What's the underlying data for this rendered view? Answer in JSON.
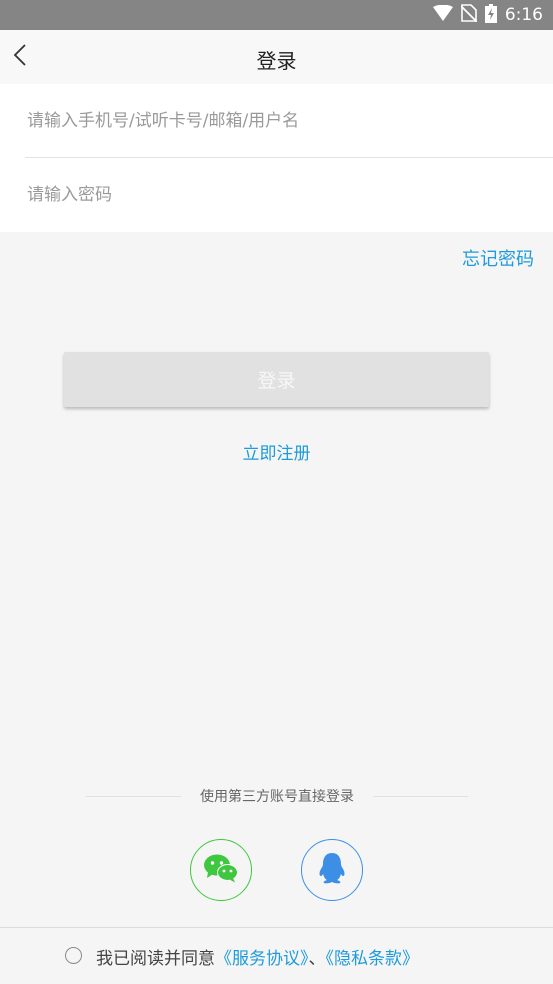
{
  "status_bar": {
    "time": "6:16",
    "icons": [
      "wifi-icon",
      "no-sim-icon",
      "battery-charging-icon"
    ]
  },
  "header": {
    "title": "登录",
    "back_icon": "chevron-left-icon"
  },
  "form": {
    "account_placeholder": "请输入手机号/试听卡号/邮箱/用户名",
    "password_placeholder": "请输入密码"
  },
  "forgot_password": "忘记密码",
  "login_button": "登录",
  "register_link": "立即注册",
  "third_party": {
    "label": "使用第三方账号直接登录",
    "providers": [
      {
        "name": "wechat",
        "icon": "wechat-icon",
        "color": "#3fc73f"
      },
      {
        "name": "qq",
        "icon": "qq-icon",
        "color": "#3d8fe6"
      }
    ]
  },
  "agreement": {
    "prefix": "我已阅读并同意",
    "service_link": "《服务协议》",
    "separator": "、",
    "privacy_link": "《隐私条款》",
    "checked": false
  },
  "colors": {
    "accent": "#1e9bdc",
    "status_bar": "#858585",
    "login_button_bg": "#e1e1e1"
  }
}
